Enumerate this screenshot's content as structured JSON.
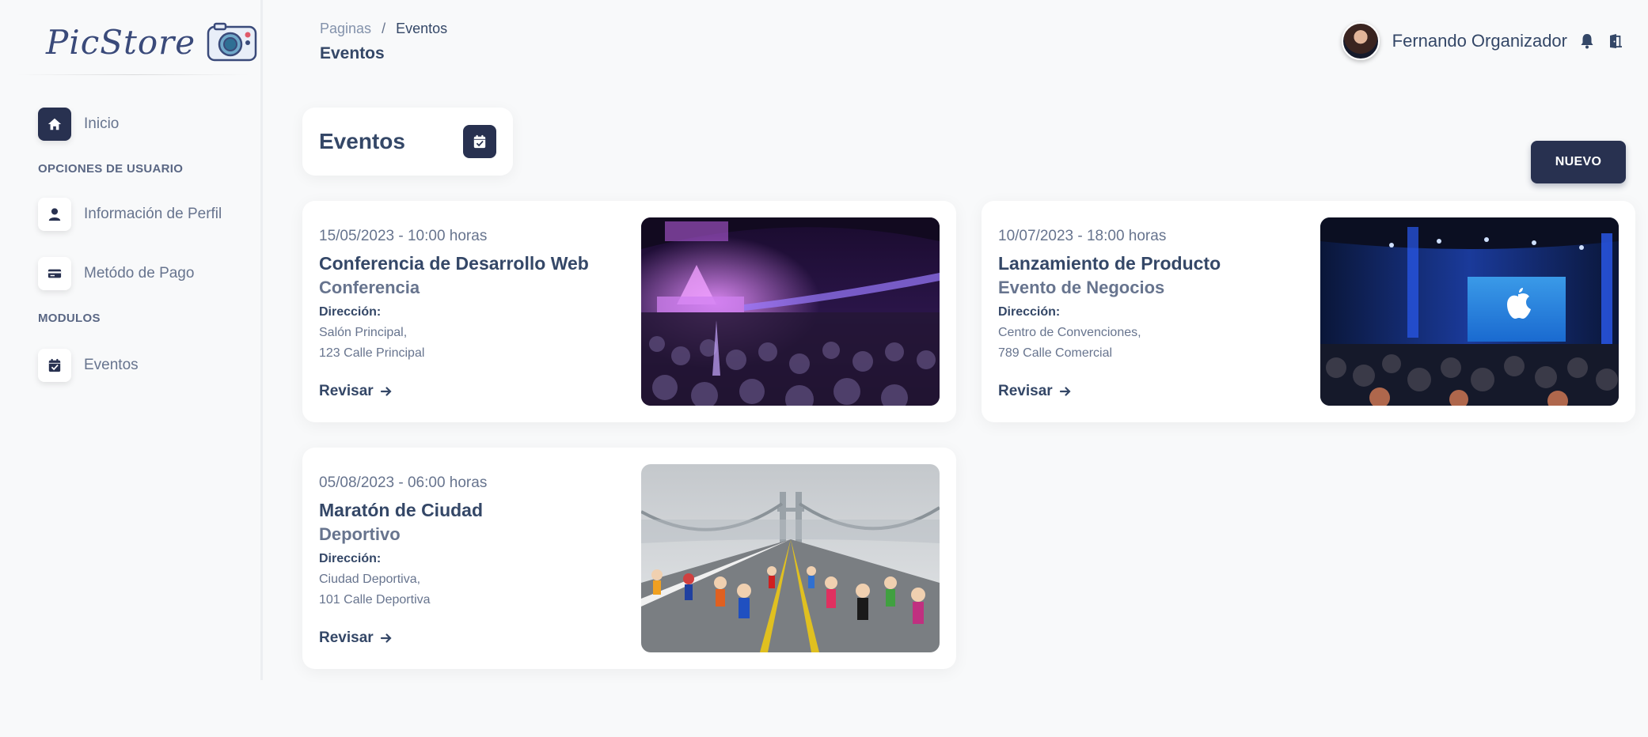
{
  "sidebar": {
    "logo_text": "PicStore",
    "items": [
      {
        "label": "Inicio",
        "icon": "home-icon",
        "active": true
      },
      {
        "section": "OPCIONES DE USUARIO"
      },
      {
        "label": "Información de Perfil",
        "icon": "user-icon"
      },
      {
        "label": "Metódo de Pago",
        "icon": "credit-card-icon"
      },
      {
        "section": "MODULOS"
      },
      {
        "label": "Eventos",
        "icon": "calendar-check-icon"
      }
    ]
  },
  "topbar": {
    "breadcrumb": {
      "root": "Paginas",
      "separator": "/",
      "current": "Eventos"
    },
    "page_title": "Eventos",
    "user_name": "Fernando Organizador",
    "icons": [
      "bell-icon",
      "logout-door-icon"
    ]
  },
  "main": {
    "header_title": "Eventos",
    "header_icon": "calendar-check-icon",
    "new_button": "NUEVO",
    "events": [
      {
        "date": "15/05/2023 - 10:00 horas",
        "title": "Conferencia de Desarrollo Web",
        "category": "Conferencia",
        "address_label": "Dirección:",
        "address_line1": "Salón Principal,",
        "address_line2": "123 Calle Principal",
        "link": "Revisar",
        "image": "conference-arena-photo"
      },
      {
        "date": "10/07/2023 - 18:00 horas",
        "title": "Lanzamiento de Producto",
        "category": "Evento de Negocios",
        "address_label": "Dirección:",
        "address_line1": "Centro de Convenciones,",
        "address_line2": "789 Calle Comercial",
        "link": "Revisar",
        "image": "product-launch-stage-photo"
      },
      {
        "date": "05/08/2023 - 06:00 horas",
        "title": "Maratón de Ciudad",
        "category": "Deportivo",
        "address_label": "Dirección:",
        "address_line1": "Ciudad Deportiva,",
        "address_line2": "101 Calle Deportiva",
        "link": "Revisar",
        "image": "marathon-bridge-photo"
      }
    ]
  },
  "colors": {
    "background": "#f8f9fa",
    "primary_dark": "#283150",
    "text_dark": "#344767",
    "text_muted": "#67748e"
  }
}
